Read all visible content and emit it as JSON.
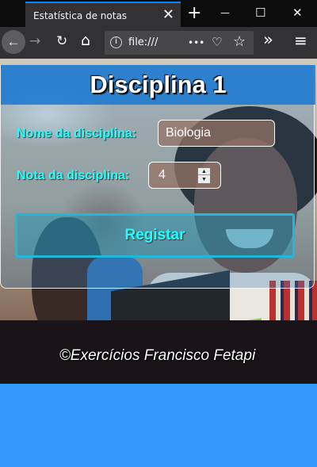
{
  "browser": {
    "tab_title": "Estatística de notas",
    "tab_close": "✕",
    "new_tab": "+",
    "win_minimize": "—",
    "win_maximize": "☐",
    "win_close": "✕",
    "back": "←",
    "forward": "→",
    "reload": "↻",
    "home": "⌂",
    "url": "file:///",
    "url_more": "•••",
    "pocket": "♡",
    "bookmark": "☆",
    "overflow": "»",
    "menu": "≡"
  },
  "panel": {
    "title": "Disciplina 1",
    "name_label": "Nome da disciplina:",
    "name_value": "Biologia",
    "grade_label": "Nota da disciplina:",
    "grade_value": "4",
    "spin_up": "▲",
    "spin_down": "▼",
    "register_label": "Registar"
  },
  "footer": {
    "note": "©Exercícios Francisco Fetapi"
  },
  "colors": {
    "label_cyan": "#22ffff",
    "header_blue": "#1878d2",
    "page_blue": "#3399ff"
  }
}
